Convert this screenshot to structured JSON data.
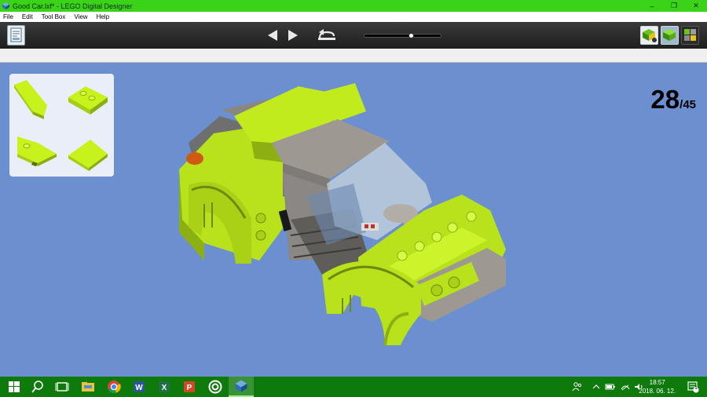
{
  "window": {
    "title": "Good Car.lxf* - LEGO Digital Designer",
    "minimize": "–",
    "restore": "❐",
    "close": "✕"
  },
  "menu": [
    "File",
    "Edit",
    "Tool Box",
    "View",
    "Help"
  ],
  "toolbar": {
    "slider_progress": 0.62
  },
  "step": {
    "current": "28",
    "separator": "/",
    "total": "45"
  },
  "colors": {
    "titlebar": "#3bd317",
    "taskbar": "#0f7a0c",
    "viewport": "#6b8fcf",
    "lime": "#b8e21b",
    "gray": "#9c9894"
  },
  "taskbar": {
    "time": "18:57",
    "date": "2018. 06. 12.",
    "notifications": "1"
  }
}
